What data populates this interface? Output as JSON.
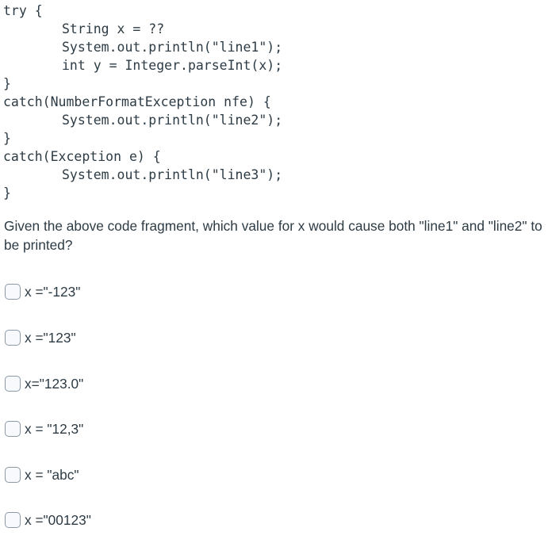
{
  "code": {
    "lines": [
      {
        "text": "try {",
        "indent": false
      },
      {
        "text": "String x = ??",
        "indent": true
      },
      {
        "text": "System.out.println(\"line1\");",
        "indent": true
      },
      {
        "text": "int y = Integer.parseInt(x);",
        "indent": true
      },
      {
        "text": "}",
        "indent": false
      },
      {
        "text": "catch(NumberFormatException nfe) {",
        "indent": false
      },
      {
        "text": "System.out.println(\"line2\");",
        "indent": true
      },
      {
        "text": "}",
        "indent": false
      },
      {
        "text": "catch(Exception e) {",
        "indent": false
      },
      {
        "text": "System.out.println(\"line3\");",
        "indent": true
      },
      {
        "text": "}",
        "indent": false
      }
    ]
  },
  "question": {
    "text": "Given the above code fragment, which value for x would cause both \"line1\" and \"line2\" to be printed?"
  },
  "options": [
    {
      "label": "x =\"-123\"",
      "checked": false
    },
    {
      "label": "x =\"123\"",
      "checked": false
    },
    {
      "label": "x=\"123.0\"",
      "checked": false
    },
    {
      "label": "x = \"12,3\"",
      "checked": false
    },
    {
      "label": "x = \"abc\"",
      "checked": false
    },
    {
      "label": "x =\"00123\"",
      "checked": false
    }
  ]
}
